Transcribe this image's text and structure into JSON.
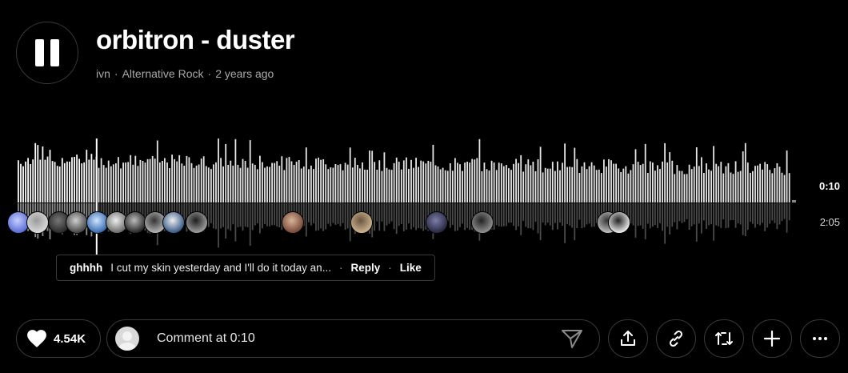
{
  "track": {
    "title": "orbitron - duster",
    "artist": "ivn",
    "genre": "Alternative Rock",
    "posted": "2 years ago"
  },
  "player": {
    "state": "playing",
    "current_time": "0:10",
    "duration": "2:05",
    "progress": 0.08
  },
  "tooltip": {
    "user": "ghhhh",
    "text": "I cut my skin yesterday and I'll do it today an...",
    "reply_label": "Reply",
    "like_label": "Like"
  },
  "footer": {
    "likes_count": "4.54K",
    "comment_placeholder": "Comment at 0:10"
  },
  "colors": {
    "background": "#000000",
    "played_wave": "#ffffff",
    "unplayed_wave": "#e6e6e6",
    "button_border": "#3a3a3a"
  },
  "icons": [
    "pause-icon",
    "heart-icon",
    "user-placeholder-icon",
    "send-icon",
    "share-icon",
    "link-icon",
    "repost-icon",
    "plus-icon",
    "more-icon"
  ]
}
